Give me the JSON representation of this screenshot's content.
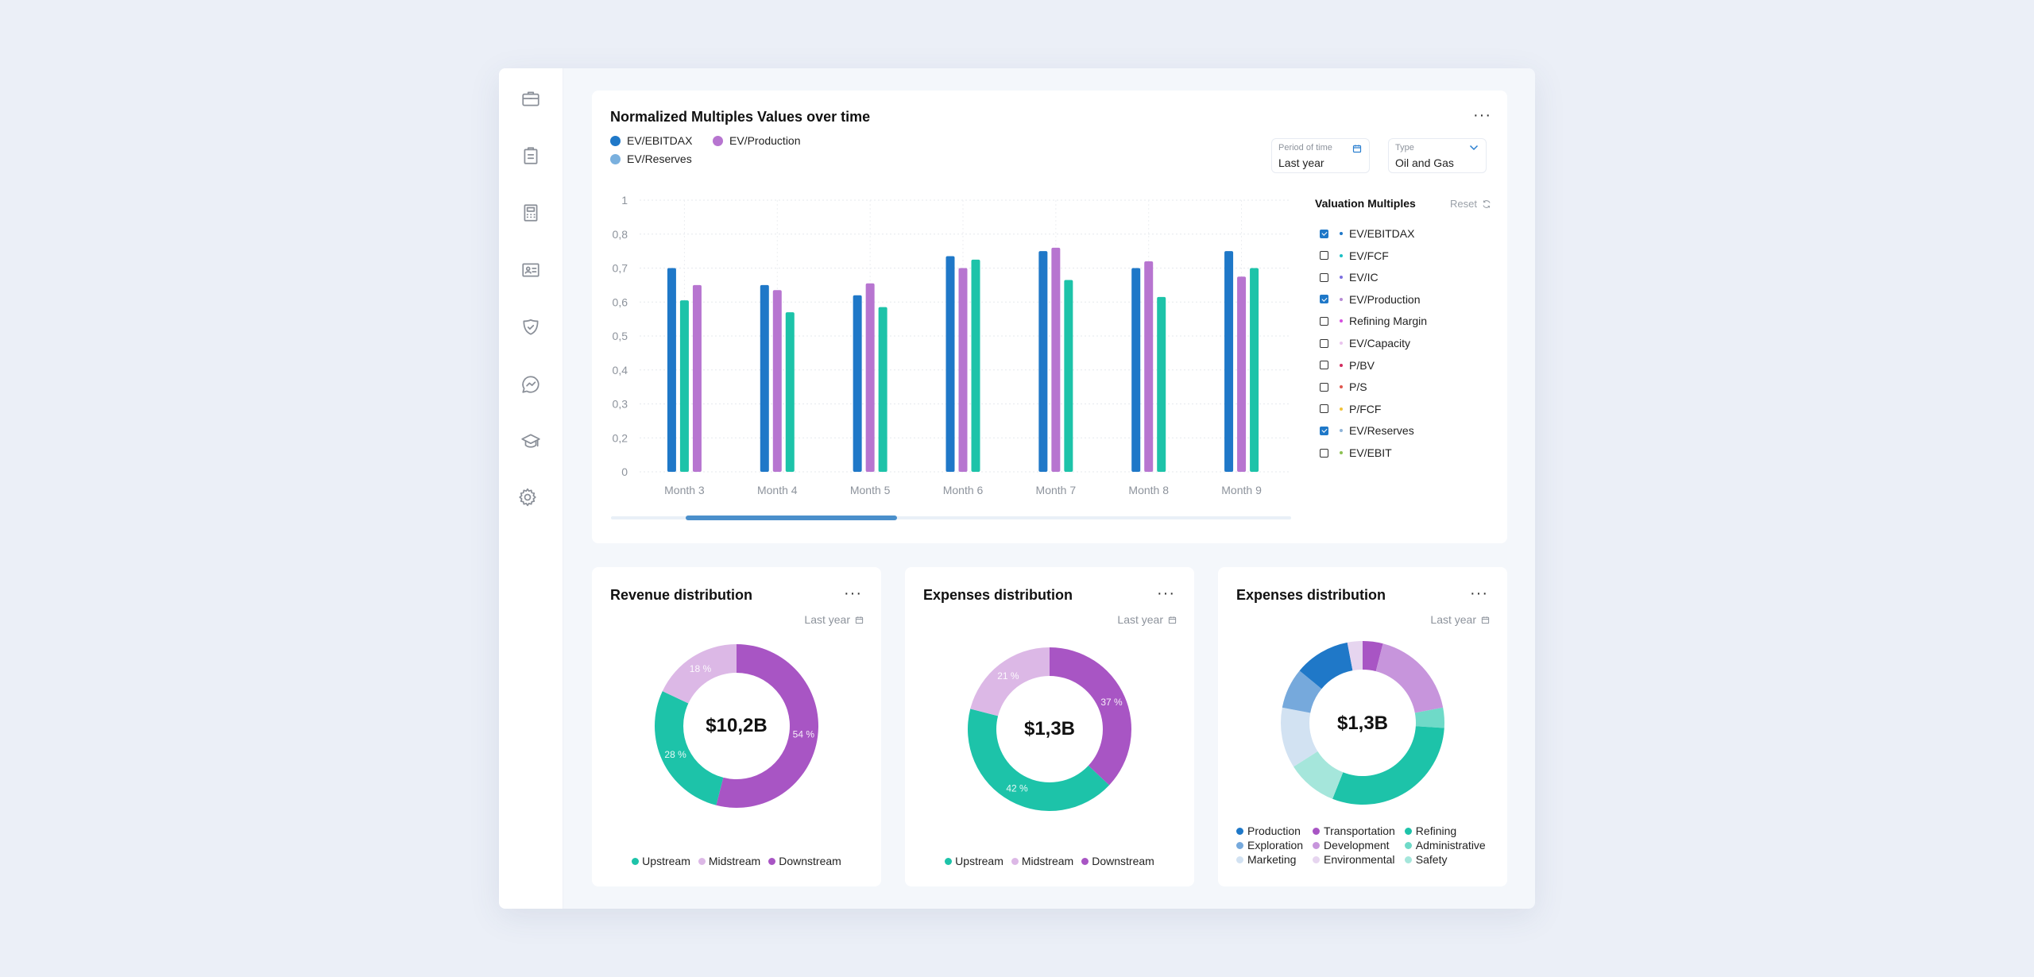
{
  "sidebar": {
    "items": [
      {
        "name": "briefcase"
      },
      {
        "name": "clipboard"
      },
      {
        "name": "calculator"
      },
      {
        "name": "id-card"
      },
      {
        "name": "shield-check"
      },
      {
        "name": "chat-chart"
      },
      {
        "name": "graduation-cap"
      },
      {
        "name": "settings"
      }
    ]
  },
  "main_chart": {
    "title": "Normalized Multiples Values over time",
    "legend": [
      {
        "label": "EV/EBITDAX",
        "color": "#1f78c8"
      },
      {
        "label": "EV/Production",
        "color": "#b775d0"
      },
      {
        "label": "EV/Reserves",
        "color": "#7ab0de"
      }
    ],
    "period_field": {
      "label": "Period of time",
      "value": "Last year"
    },
    "type_field": {
      "label": "Type",
      "value": "Oil and Gas"
    },
    "valuation_multiples": {
      "title": "Valuation Multiples",
      "reset_label": "Reset",
      "items": [
        {
          "label": "EV/EBITDAX",
          "checked": true,
          "color": "#1f78c8"
        },
        {
          "label": "EV/FCF",
          "checked": false,
          "color": "#1bbfc4"
        },
        {
          "label": "EV/IC",
          "checked": false,
          "color": "#7c6fe0"
        },
        {
          "label": "EV/Production",
          "checked": true,
          "color": "#b78ad4"
        },
        {
          "label": "Refining Margin",
          "checked": false,
          "color": "#d54fe0"
        },
        {
          "label": "EV/Capacity",
          "checked": false,
          "color": "#eac4ee"
        },
        {
          "label": "P/BV",
          "checked": false,
          "color": "#d12b5e"
        },
        {
          "label": "P/S",
          "checked": false,
          "color": "#e0574e"
        },
        {
          "label": "P/FCF",
          "checked": false,
          "color": "#f0c23a"
        },
        {
          "label": "EV/Reserves",
          "checked": true,
          "color": "#8fb4d8"
        },
        {
          "label": "EV/EBIT",
          "checked": false,
          "color": "#8cc152"
        }
      ]
    },
    "scroll_position": {
      "start": 0.11,
      "end": 0.42
    }
  },
  "chart_data": [
    {
      "type": "bar",
      "title": "Normalized Multiples Values over time",
      "categories": [
        "Month 3",
        "Month 4",
        "Month 5",
        "Month 6",
        "Month 7",
        "Month 8",
        "Month 9"
      ],
      "y_ticks": [
        "0",
        "0,2",
        "0,3",
        "0,4",
        "0,5",
        "0,6",
        "0,7",
        "0,8",
        "1"
      ],
      "y_tick_values": [
        0,
        0.2,
        0.3,
        0.4,
        0.5,
        0.6,
        0.7,
        0.8,
        1
      ],
      "series_order_note": "bars drawn per category in listed order",
      "bars": [
        [
          {
            "series": "EV/EBITDAX",
            "value": 0.7,
            "color": "#1f78c8"
          },
          {
            "series": "EV/Reserves",
            "value": 0.605,
            "color": "#1dc3a9"
          },
          {
            "series": "EV/Production",
            "value": 0.65,
            "color": "#b775d0"
          }
        ],
        [
          {
            "series": "EV/EBITDAX",
            "value": 0.65,
            "color": "#1f78c8"
          },
          {
            "series": "EV/Production",
            "value": 0.635,
            "color": "#b775d0"
          },
          {
            "series": "EV/Reserves",
            "value": 0.57,
            "color": "#1dc3a9"
          }
        ],
        [
          {
            "series": "EV/EBITDAX",
            "value": 0.62,
            "color": "#1f78c8"
          },
          {
            "series": "EV/Production",
            "value": 0.655,
            "color": "#b775d0"
          },
          {
            "series": "EV/Reserves",
            "value": 0.585,
            "color": "#1dc3a9"
          }
        ],
        [
          {
            "series": "EV/EBITDAX",
            "value": 0.735,
            "color": "#1f78c8"
          },
          {
            "series": "EV/Production",
            "value": 0.7,
            "color": "#b775d0"
          },
          {
            "series": "EV/Reserves",
            "value": 0.725,
            "color": "#1dc3a9"
          }
        ],
        [
          {
            "series": "EV/EBITDAX",
            "value": 0.75,
            "color": "#1f78c8"
          },
          {
            "series": "EV/Production",
            "value": 0.76,
            "color": "#b775d0"
          },
          {
            "series": "EV/Reserves",
            "value": 0.665,
            "color": "#1dc3a9"
          }
        ],
        [
          {
            "series": "EV/EBITDAX",
            "value": 0.7,
            "color": "#1f78c8"
          },
          {
            "series": "EV/Production",
            "value": 0.72,
            "color": "#b775d0"
          },
          {
            "series": "EV/Reserves",
            "value": 0.615,
            "color": "#1dc3a9"
          }
        ],
        [
          {
            "series": "EV/EBITDAX",
            "value": 0.75,
            "color": "#1f78c8"
          },
          {
            "series": "EV/Production",
            "value": 0.675,
            "color": "#b775d0"
          },
          {
            "series": "EV/Reserves",
            "value": 0.7,
            "color": "#1dc3a9"
          }
        ]
      ],
      "grid": true,
      "ylim": [
        0,
        1
      ]
    },
    {
      "type": "pie",
      "title": "Revenue distribution",
      "center_label": "$10,2B",
      "slices": [
        {
          "label": "Downstream",
          "value": 54,
          "color": "#a855c4",
          "text": "54 %"
        },
        {
          "label": "Upstream",
          "value": 28,
          "color": "#1dc3a9",
          "text": "28 %"
        },
        {
          "label": "Midstream",
          "value": 18,
          "color": "#dcb8e6",
          "text": "18 %"
        }
      ]
    },
    {
      "type": "pie",
      "title": "Expenses distribution",
      "center_label": "$1,3B",
      "slices": [
        {
          "label": "Downstream",
          "value": 37,
          "color": "#a855c4",
          "text": "37 %"
        },
        {
          "label": "Upstream",
          "value": 42,
          "color": "#1dc3a9",
          "text": "42 %"
        },
        {
          "label": "Midstream",
          "value": 21,
          "color": "#dcb8e6",
          "text": "21 %"
        }
      ]
    },
    {
      "type": "pie",
      "title": "Expenses distribution",
      "center_label": "$1,3B",
      "slices": [
        {
          "label": "Transportation",
          "value": 4,
          "color": "#a855c4"
        },
        {
          "label": "Development",
          "value": 18,
          "color": "#c795dc"
        },
        {
          "label": "Administrative",
          "value": 4,
          "color": "#6fdac8"
        },
        {
          "label": "Refining",
          "value": 30,
          "color": "#1dc3a9"
        },
        {
          "label": "Safety",
          "value": 10,
          "color": "#a5e6db"
        },
        {
          "label": "Marketing",
          "value": 12,
          "color": "#d2e2f2"
        },
        {
          "label": "Exploration",
          "value": 8,
          "color": "#76a9dc"
        },
        {
          "label": "Production",
          "value": 11,
          "color": "#1f78c8"
        },
        {
          "label": "Environmental",
          "value": 3,
          "color": "#e6d5ef"
        }
      ]
    }
  ],
  "donut_cards": [
    {
      "title": "Revenue distribution",
      "period": "Last year",
      "center": "$10,2B",
      "legend": [
        {
          "label": "Upstream",
          "color": "#1dc3a9"
        },
        {
          "label": "Midstream",
          "color": "#dcb8e6"
        },
        {
          "label": "Downstream",
          "color": "#a855c4"
        }
      ]
    },
    {
      "title": "Expenses distribution",
      "period": "Last year",
      "center": "$1,3B",
      "legend": [
        {
          "label": "Upstream",
          "color": "#1dc3a9"
        },
        {
          "label": "Midstream",
          "color": "#dcb8e6"
        },
        {
          "label": "Downstream",
          "color": "#a855c4"
        }
      ]
    },
    {
      "title": "Expenses distribution",
      "period": "Last year",
      "center": "$1,3B",
      "legend": [
        {
          "label": "Production",
          "color": "#1f78c8"
        },
        {
          "label": "Transportation",
          "color": "#a855c4"
        },
        {
          "label": "Refining",
          "color": "#1dc3a9"
        },
        {
          "label": "Exploration",
          "color": "#76a9dc"
        },
        {
          "label": "Development",
          "color": "#c795dc"
        },
        {
          "label": "Administrative",
          "color": "#6fdac8"
        },
        {
          "label": "Marketing",
          "color": "#d2e2f2"
        },
        {
          "label": "Environmental",
          "color": "#e6d5ef"
        },
        {
          "label": "Safety",
          "color": "#a5e6db"
        }
      ]
    }
  ]
}
